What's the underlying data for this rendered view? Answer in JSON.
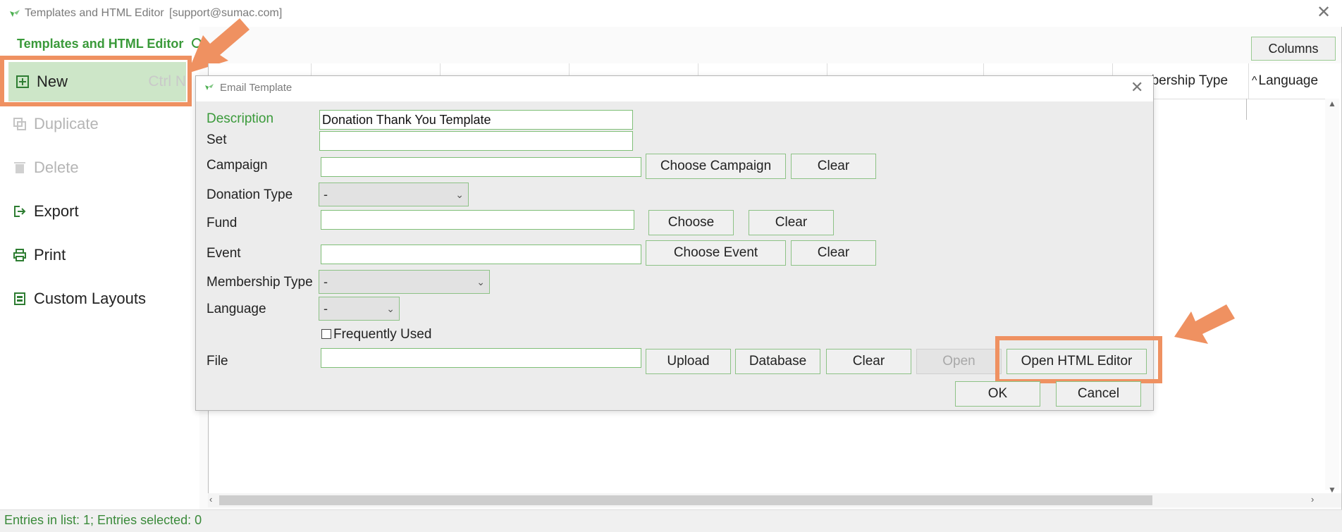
{
  "window": {
    "title": "Templates and HTML Editor",
    "user": "[support@sumac.com]",
    "close_glyph": "✕"
  },
  "sidebar": {
    "app_name": "Templates and HTML Editor",
    "items": [
      {
        "label": "New",
        "shortcut": "Ctrl N",
        "icon": "plus-box-icon",
        "glyph": "⊞",
        "enabled": true
      },
      {
        "label": "Duplicate",
        "icon": "duplicate-icon",
        "glyph": "⎘",
        "enabled": false
      },
      {
        "label": "Delete",
        "icon": "trash-icon",
        "glyph": "🗑",
        "enabled": false
      },
      {
        "label": "Export",
        "icon": "export-icon",
        "glyph": "⇥",
        "enabled": true
      },
      {
        "label": "Print",
        "icon": "printer-icon",
        "glyph": "⎙",
        "enabled": true
      },
      {
        "label": "Custom Layouts",
        "icon": "layout-icon",
        "glyph": "▤",
        "enabled": true
      }
    ]
  },
  "list": {
    "columns_button": "Columns",
    "visible_headers": [
      "nbership Type",
      "Language"
    ],
    "sort_indicator": "^"
  },
  "status": {
    "text": "Entries in list: 1; Entries selected: 0"
  },
  "dialog": {
    "title": "Email Template",
    "close_glyph": "✕",
    "fields": {
      "description": {
        "label": "Description",
        "value": "Donation Thank You Template"
      },
      "set": {
        "label": "Set",
        "value": ""
      },
      "campaign": {
        "label": "Campaign",
        "value": "",
        "choose": "Choose Campaign",
        "clear": "Clear"
      },
      "donation_type": {
        "label": "Donation Type",
        "selected": "-"
      },
      "fund": {
        "label": "Fund",
        "value": "",
        "choose": "Choose",
        "clear": "Clear"
      },
      "event": {
        "label": "Event",
        "value": "",
        "choose": "Choose Event",
        "clear": "Clear"
      },
      "membership_type": {
        "label": "Membership Type",
        "selected": "-"
      },
      "language": {
        "label": "Language",
        "selected": "-"
      },
      "frequently_used": {
        "label": "Frequently Used",
        "checked": false
      },
      "file": {
        "label": "File",
        "value": "",
        "upload": "Upload",
        "database": "Database",
        "clear": "Clear",
        "open": "Open",
        "open_html_editor": "Open HTML Editor"
      }
    },
    "ok": "OK",
    "cancel": "Cancel"
  },
  "colors": {
    "accent_green": "#3a9a3a",
    "highlight_orange": "#ef9161",
    "selected_bg": "#cde6c8"
  }
}
